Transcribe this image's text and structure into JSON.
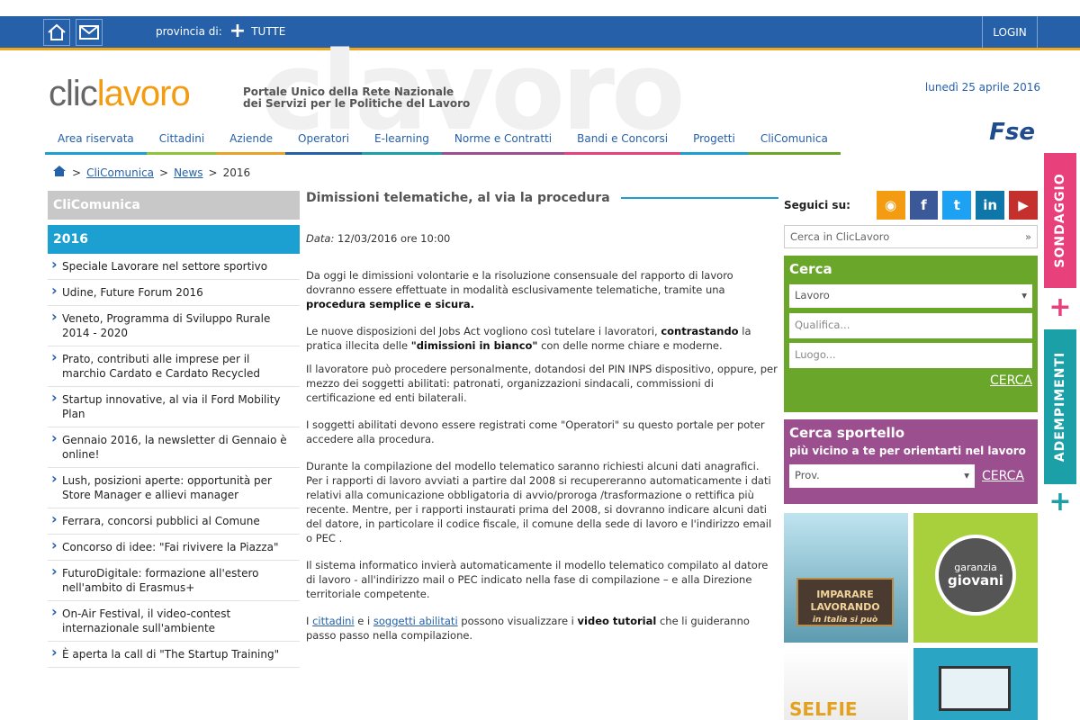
{
  "topbar": {
    "provincia_label": "provincia di:",
    "provincia_value": "TUTTE",
    "login_label": "LOGIN"
  },
  "header": {
    "logo_clic": "clic",
    "logo_lavoro": "lavoro",
    "logo_sub": [
      "Portale Unico della Rete Nazionale",
      "dei Servizi per le Politiche del Lavoro"
    ],
    "date": "lunedì 25 aprile 2016",
    "fse": "Fse",
    "nav": [
      "Area riservata",
      "Cittadini",
      "Aziende",
      "Operatori",
      "E-learning",
      "Norme e Contratti",
      "Bandi e Concorsi",
      "Progetti",
      "CliComunica"
    ],
    "nav_colors": [
      "#1ca0d2",
      "#8fc33a",
      "#e9a126",
      "#2560a8",
      "#1ca0a8",
      "#9b4f8f",
      "#e8407a",
      "#1ca0d2",
      "#6aa62a"
    ]
  },
  "breadcrumb": {
    "sep": ">",
    "items": [
      "CliComunica",
      "News",
      "2016"
    ]
  },
  "left": {
    "section": "CliComunica",
    "year": "2016",
    "items": [
      "Speciale Lavorare nel settore sportivo",
      "Udine, Future Forum 2016",
      "Veneto, Programma di Sviluppo Rurale 2014 - 2020",
      "Prato, contributi alle imprese per il marchio Cardato e Cardato Recycled",
      "Startup innovative, al via il Ford Mobility Plan",
      "Gennaio 2016, la newsletter di Gennaio è online!",
      "Lush, posizioni aperte: opportunità per Store Manager e allievi manager",
      "Ferrara, concorsi pubblici al Comune",
      "Concorso di idee: \"Fai rivivere la Piazza\"",
      "FuturoDigitale: formazione all'estero nell'ambito di Erasmus+",
      "On-Air Festival, il video-contest internazionale sull'ambiente",
      "È aperta la call di \"The Startup Training\""
    ]
  },
  "article": {
    "title": "Dimissioni telematiche, al via la procedura",
    "date_label": "Data:",
    "date_value": "12/03/2016 ore 10:00",
    "p1a": "Da oggi le dimissioni volontarie e la risoluzione consensuale del rapporto di lavoro dovranno essere effettuate in modalità esclusivamente telematiche, tramite una ",
    "p1b": "procedura semplice e sicura.",
    "p2a": "Le nuove disposizioni del Jobs Act vogliono così tutelare i lavoratori, ",
    "p2b": "contrastando",
    "p2c": " la pratica illecita delle ",
    "p2d": "\"dimissioni in bianco\"",
    "p2e": "  con delle norme chiare e moderne.",
    "p3": "Il lavoratore può procedere personalmente, dotandosi del PIN INPS dispositivo, oppure, per mezzo dei soggetti abilitati: patronati, organizzazioni sindacali, commissioni di certificazione ed enti bilaterali.",
    "p4": "I soggetti abilitati devono essere registrati come \"Operatori\" su questo portale per poter accedere alla procedura.",
    "p5": "Durante la compilazione del modello telematico saranno richiesti alcuni dati anagrafici. Per i rapporti di lavoro avviati a partire dal 2008 si recupereranno automaticamente i dati relativi alla comunicazione obbligatoria di avvio/proroga /trasformazione o rettifica più recente. Mentre, per i rapporti instaurati prima del 2008, si dovranno indicare alcuni dati del datore, in particolare il codice fiscale, il comune della sede di lavoro e l'indirizzo email o PEC .",
    "p6": "Il sistema informatico invierà automaticamente il modello telematico compilato al datore di lavoro - all'indirizzo mail o PEC indicato nella fase di compilazione – e alla Direzione territoriale competente.",
    "p7a": "I ",
    "p7b": "cittadini",
    "p7c": " e i ",
    "p7d": "soggetti abilitati",
    "p7e": " possono visualizzare i ",
    "p7f": "video tutorial",
    "p7g": " che li guideranno passo passo nella compilazione."
  },
  "right": {
    "seguici": "Seguici su:",
    "social": [
      {
        "name": "rss",
        "glyph": "◉",
        "color": "#f39c12"
      },
      {
        "name": "facebook",
        "glyph": "f",
        "color": "#3b5998"
      },
      {
        "name": "twitter",
        "glyph": "t",
        "color": "#1da1f2"
      },
      {
        "name": "linkedin",
        "glyph": "in",
        "color": "#0e76a8"
      },
      {
        "name": "youtube",
        "glyph": "▶",
        "color": "#c4302b"
      }
    ],
    "search_placeholder": "Cerca in ClicLavoro",
    "search_arrow": "»",
    "cerca_title": "Cerca",
    "cerca_select": "Lavoro",
    "qualifica_placeholder": "Qualifica...",
    "luogo_placeholder": "Luogo...",
    "cerca_link": "CERCA",
    "sportello_title": "Cerca sportello",
    "sportello_sub": "più vicino a te per orientarti nel lavoro",
    "prov_select": "Prov.",
    "sportello_link": "CERCA",
    "banner1": "IMPARARE LAVORANDO",
    "banner1_sub": "in Italia si può",
    "banner2a": "garanzia",
    "banner2b": "giovani",
    "banner3": "SELFIE"
  },
  "sidetabs": {
    "sondaggio": "SONDAGGIO",
    "adempimenti": "ADEMPIMENTI",
    "plus": "+"
  }
}
